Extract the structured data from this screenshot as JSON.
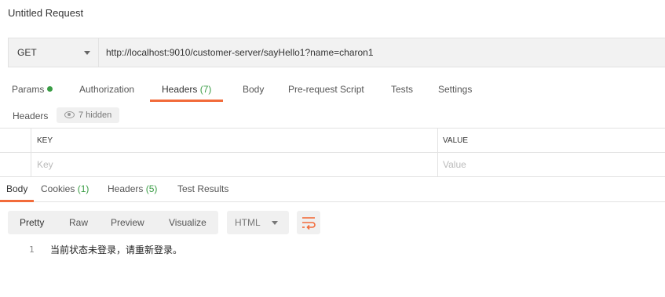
{
  "request": {
    "title": "Untitled Request",
    "method": "GET",
    "url": "http://localhost:9010/customer-server/sayHello1?name=charon1"
  },
  "request_tabs": [
    {
      "label": "Params",
      "count": "",
      "dot": true
    },
    {
      "label": "Authorization",
      "count": ""
    },
    {
      "label": "Headers",
      "count": "(7)",
      "active": true
    },
    {
      "label": "Body",
      "count": ""
    },
    {
      "label": "Pre-request Script",
      "count": ""
    },
    {
      "label": "Tests",
      "count": ""
    },
    {
      "label": "Settings",
      "count": ""
    }
  ],
  "headers_section": {
    "label": "Headers",
    "hidden_text": "7 hidden",
    "col_key": "KEY",
    "col_value": "VALUE",
    "key_placeholder": "Key",
    "value_placeholder": "Value"
  },
  "response_tabs": [
    {
      "label": "Body",
      "count": "",
      "active": true
    },
    {
      "label": "Cookies",
      "count": "(1)"
    },
    {
      "label": "Headers",
      "count": "(5)"
    },
    {
      "label": "Test Results",
      "count": ""
    }
  ],
  "view_modes": [
    "Pretty",
    "Raw",
    "Preview",
    "Visualize"
  ],
  "active_view": "Pretty",
  "format": "HTML",
  "response_body": {
    "line_number": "1",
    "text": "当前状态未登录，请重新登录。"
  },
  "colors": {
    "accent": "#f26b3a",
    "status_green": "#3a9d45"
  },
  "icons": [
    "chevron-down-icon",
    "eye-icon",
    "wrap-lines-icon",
    "status-dot-icon"
  ]
}
